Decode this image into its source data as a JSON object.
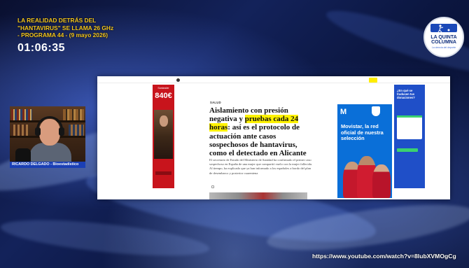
{
  "overlay": {
    "title_line1": "LA REALIDAD DETRÁS DEL",
    "title_line2": "\"HANTAVIRUS\" SE LLAMA 26 GHz",
    "title_line3": "- PROGRAMA 44 - (9 mayo 2026)",
    "timer": "01:06:35",
    "video_url": "https://www.youtube.com/watch?v=8lubXVMOgCg"
  },
  "logo": {
    "line1": "LA QUINTA",
    "line2": "COLUMNA",
    "tagline": "La ciencia del deporte"
  },
  "webcam": {
    "name_label": "RICARDO DELGADO - Bioestadístico"
  },
  "article": {
    "section": "SALUD",
    "headline_part1": "Aislamiento con presión negativa y ",
    "headline_highlight": "pruebas cada 24 horas",
    "headline_part2": ": así es el protocolo de actuación ante casos sospechosos de hantavirus, como el detectado en Alicante",
    "body": "El secretario de Estado del Ministerio de Sanidad ha confirmado el primer caso sospechoso en España de una mujer que compartió vuelo con la mujer fallecida. Al tiempo, ha explicado que ya han informado a los españoles a bordo del plan de desembarco y posterior cuarentena"
  },
  "ads": {
    "left_brand": "Santander",
    "left_price": "840€",
    "mid_brand": "M",
    "mid_text": "Movistar, la red oficial de nuestra selección",
    "right_text": "¿En qué se traducen tus donaciones?"
  },
  "colors": {
    "overlay_title": "#f3c51b",
    "name_bar": "#1a3fb5",
    "highlight": "#fff200",
    "movistar_blue": "#0a6fd8",
    "santander_red": "#c8141c"
  }
}
